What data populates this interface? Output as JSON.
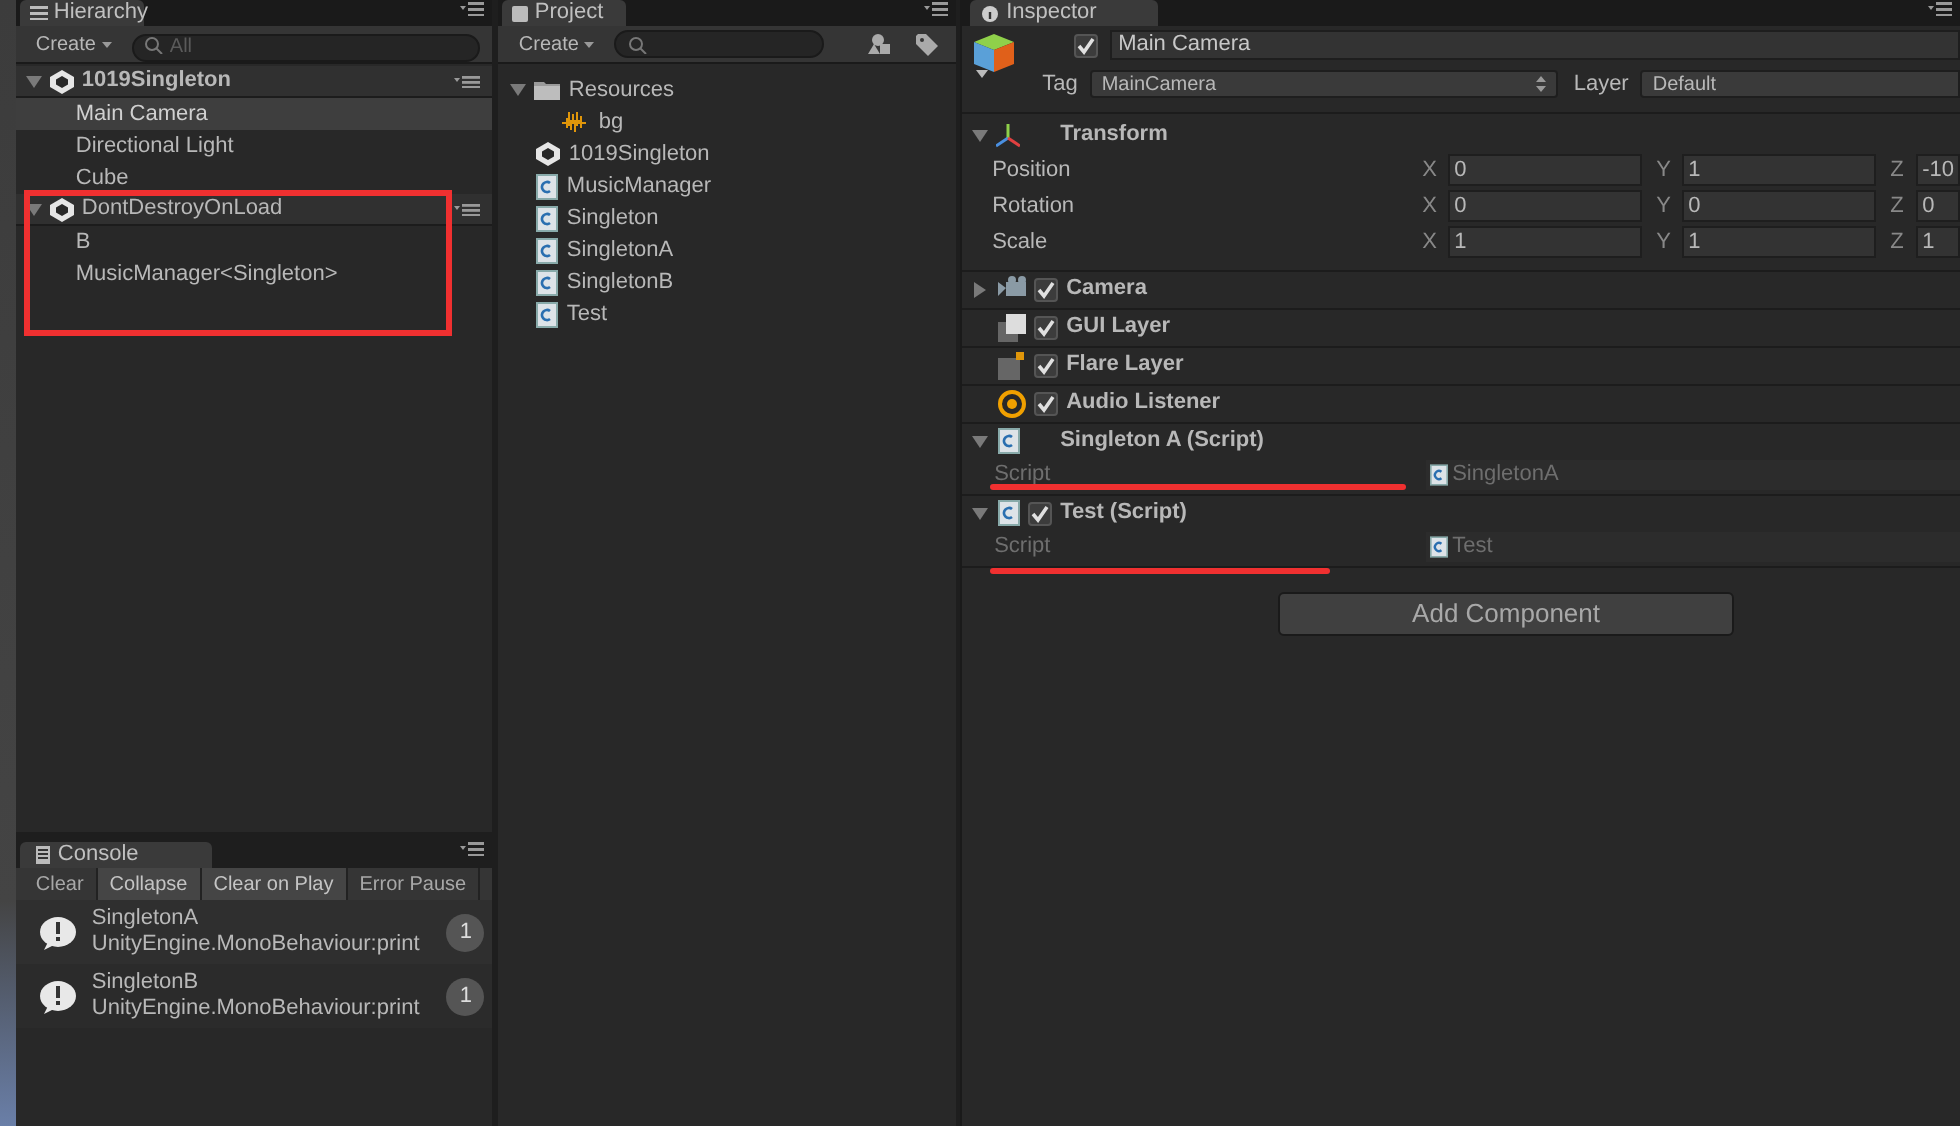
{
  "hierarchy": {
    "tab": "Hierarchy",
    "create": "Create",
    "search": {
      "placeholder": "All"
    },
    "scenes": [
      {
        "name": "1019Singleton",
        "highlighted": false,
        "children": [
          {
            "label": "Main Camera",
            "selected": true
          },
          {
            "label": "Directional Light",
            "selected": false
          },
          {
            "label": "Cube",
            "selected": false
          }
        ]
      },
      {
        "name": "DontDestroyOnLoad",
        "highlighted": true,
        "children": [
          {
            "label": "B",
            "selected": false
          },
          {
            "label": "MusicManager<Singleton>",
            "selected": false
          }
        ]
      }
    ]
  },
  "console": {
    "tab": "Console",
    "buttons": [
      {
        "label": "Clear",
        "on": false
      },
      {
        "label": "Collapse",
        "on": true
      },
      {
        "label": "Clear on Play",
        "on": true
      },
      {
        "label": "Error Pause",
        "on": false
      }
    ],
    "messages": [
      {
        "title": "SingletonA",
        "detail": "UnityEngine.MonoBehaviour:print",
        "count": "1"
      },
      {
        "title": "SingletonB",
        "detail": "UnityEngine.MonoBehaviour:print",
        "count": "1"
      }
    ]
  },
  "project": {
    "tab": "Project",
    "create": "Create",
    "items": [
      {
        "label": "Resources",
        "kind": "folder",
        "expanded": true,
        "children": [
          {
            "label": "bg",
            "kind": "audio"
          }
        ]
      },
      {
        "label": "1019Singleton",
        "kind": "scene"
      },
      {
        "label": "MusicManager",
        "kind": "script"
      },
      {
        "label": "Singleton",
        "kind": "script"
      },
      {
        "label": "SingletonA",
        "kind": "script"
      },
      {
        "label": "SingletonB",
        "kind": "script"
      },
      {
        "label": "Test",
        "kind": "script"
      }
    ]
  },
  "inspector": {
    "tab": "Inspector",
    "object": {
      "active": true,
      "name": "Main Camera",
      "tag_label": "Tag",
      "tag": "MainCamera",
      "layer_label": "Layer",
      "layer": "Default"
    },
    "transform": {
      "title": "Transform",
      "expanded": true,
      "rows": [
        {
          "label": "Position",
          "values": [
            {
              "axis": "X",
              "value": "0"
            },
            {
              "axis": "Y",
              "value": "1"
            },
            {
              "axis": "Z",
              "value": "-10"
            }
          ]
        },
        {
          "label": "Rotation",
          "values": [
            {
              "axis": "X",
              "value": "0"
            },
            {
              "axis": "Y",
              "value": "0"
            },
            {
              "axis": "Z",
              "value": "0"
            }
          ]
        },
        {
          "label": "Scale",
          "values": [
            {
              "axis": "X",
              "value": "1"
            },
            {
              "axis": "Y",
              "value": "1"
            },
            {
              "axis": "Z",
              "value": "1"
            }
          ]
        }
      ]
    },
    "components": [
      {
        "title": "Camera",
        "kind": "camera",
        "enabled": true,
        "expanded": false
      },
      {
        "title": "GUI Layer",
        "kind": "gui",
        "enabled": true
      },
      {
        "title": "Flare Layer",
        "kind": "flare",
        "enabled": true
      },
      {
        "title": "Audio Listener",
        "kind": "audio",
        "enabled": true
      },
      {
        "title": "Singleton A (Script)",
        "kind": "script",
        "expanded": true,
        "underlined": true,
        "fields": [
          {
            "label": "Script",
            "value": "SingletonA"
          }
        ]
      },
      {
        "title": "Test (Script)",
        "kind": "script",
        "enabled": true,
        "expanded": true,
        "underlined": true,
        "fields": [
          {
            "label": "Script",
            "value": "Test"
          }
        ]
      }
    ],
    "add_component": "Add Component"
  }
}
